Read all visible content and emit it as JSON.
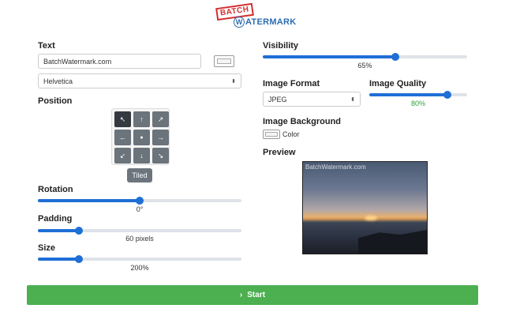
{
  "logo": {
    "top_word": "BATCH",
    "w_letter": "W",
    "rest": "ATERMARK"
  },
  "text_section": {
    "label": "Text",
    "value": "BatchWatermark.com",
    "font": "Helvetica"
  },
  "position": {
    "label": "Position",
    "cells": [
      "↖",
      "↑",
      "↗",
      "←",
      "●",
      "→",
      "↙",
      "↓",
      "↘"
    ],
    "active_index": 0,
    "tiled_label": "Tiled"
  },
  "rotation": {
    "label": "Rotation",
    "value_text": "0°",
    "fraction": 0.5
  },
  "padding": {
    "label": "Padding",
    "value_text": "60 pixels",
    "fraction": 0.2
  },
  "size": {
    "label": "Size",
    "value_text": "200%",
    "fraction": 0.2
  },
  "visibility": {
    "label": "Visibility",
    "value_text": "65%",
    "fraction": 0.65
  },
  "image_format": {
    "label": "Image Format",
    "value": "JPEG"
  },
  "image_quality": {
    "label": "Image Quality",
    "value_text": "80%",
    "fraction": 0.8,
    "value_color": "#2e9e3e"
  },
  "image_background": {
    "label": "Image Background",
    "swatch_label": "Color"
  },
  "preview": {
    "label": "Preview",
    "watermark_text": "BatchWatermark.com"
  },
  "start": {
    "label": "Start",
    "icon": "chevron-right"
  },
  "colors": {
    "accent": "#1f6fd6",
    "start": "#4caf50",
    "logo_red": "#d32f2f",
    "logo_blue": "#2b6cb0"
  }
}
